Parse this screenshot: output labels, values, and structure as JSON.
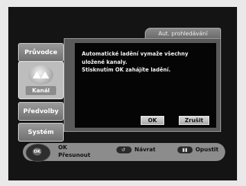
{
  "sidebar": {
    "items": [
      {
        "label": "Průvodce"
      },
      {
        "label": "Kanál"
      },
      {
        "label": "Předvolby"
      },
      {
        "label": "Systém"
      }
    ]
  },
  "dialog": {
    "title": "Aut. prohledávání",
    "lines": [
      "Automatické ladění vymaže všechny",
      "uložené kanaly.",
      "Stisknutím OK zahájíte ladění."
    ],
    "ok_label": "OK",
    "cancel_label": "Zrušit"
  },
  "footer": {
    "nav_center": "OK",
    "ok_hint": "OK",
    "move_hint": "Přesunout",
    "back_label": "Návrat",
    "exit_label": "Opustit"
  }
}
